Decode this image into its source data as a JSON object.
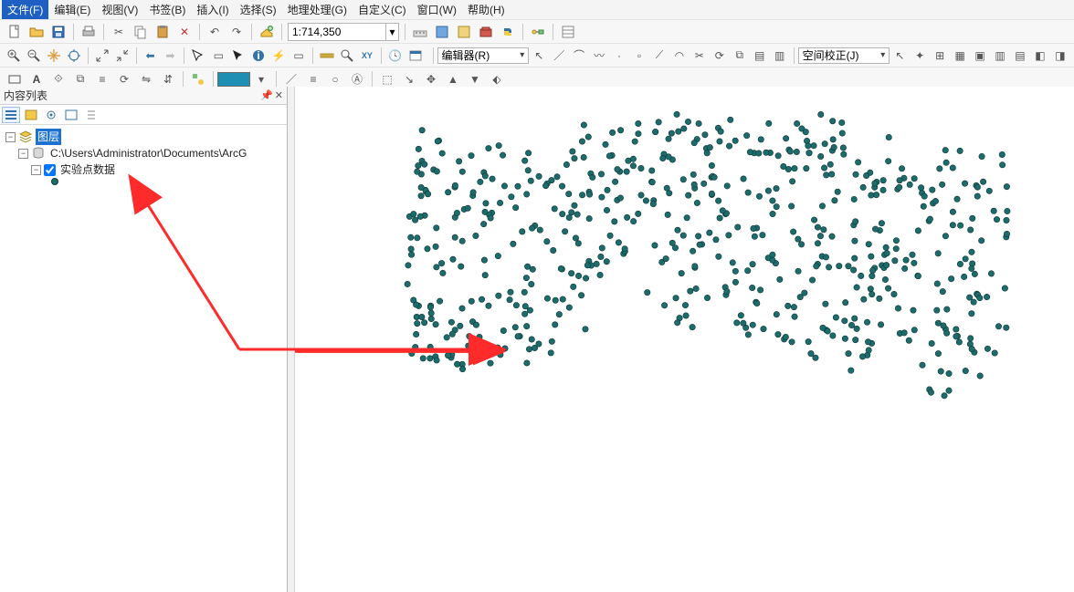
{
  "menu": {
    "items": [
      "文件(F)",
      "编辑(E)",
      "视图(V)",
      "书签(B)",
      "插入(I)",
      "选择(S)",
      "地理处理(G)",
      "自定义(C)",
      "窗口(W)",
      "帮助(H)"
    ]
  },
  "toolbar1": {
    "scale_label": "1:714,350"
  },
  "toolbar2": {
    "editor_label": "编辑器(R)",
    "spatial_adjust_label": "空间校正(J)"
  },
  "toc": {
    "title": "内容列表",
    "layers_label": "图层",
    "data_path": "C:\\Users\\Administrator\\Documents\\ArcG",
    "layer_name": "实验点数据"
  },
  "points": {
    "count": 610,
    "seed": 42,
    "color": "#1e6b6b",
    "region_description": "点状要素散布于地图视图中部，呈不规则区域分布"
  }
}
